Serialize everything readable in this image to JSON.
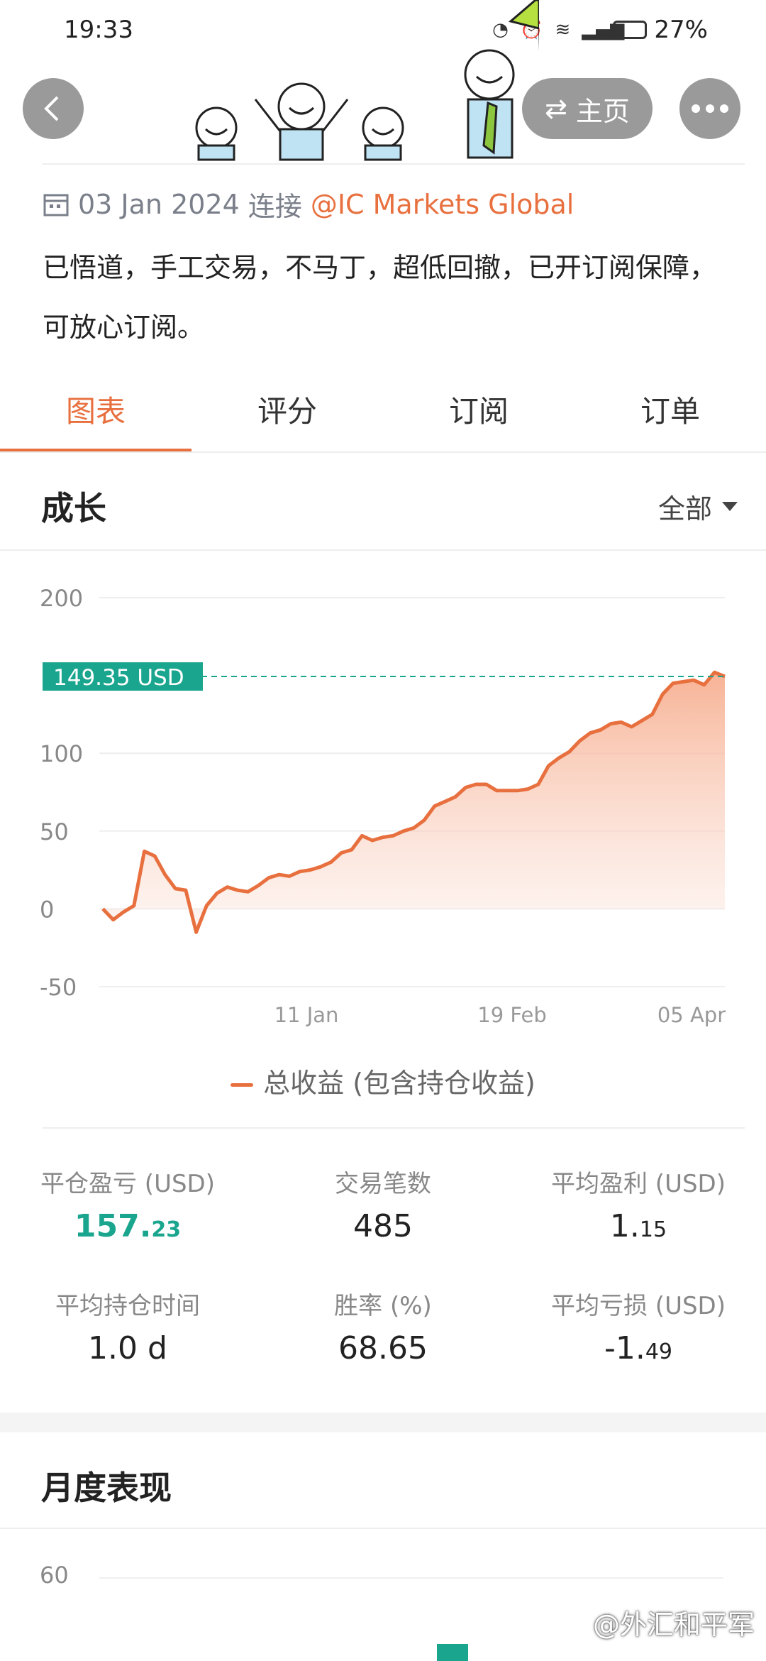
{
  "status_bar": {
    "time": "19:33",
    "battery": "27%"
  },
  "header": {
    "home_label": "主页"
  },
  "profile": {
    "date": "03 Jan 2024",
    "connect_label": "连接",
    "broker": "@IC Markets Global",
    "description": "已悟道，手工交易，不马丁，超低回撤，已开订阅保障，可放心订阅。"
  },
  "tabs": [
    {
      "label": "图表",
      "active": true
    },
    {
      "label": "评分",
      "active": false
    },
    {
      "label": "订阅",
      "active": false
    },
    {
      "label": "订单",
      "active": false
    }
  ],
  "growth": {
    "title": "成长",
    "filter": "全部",
    "current_badge": "149.35 USD"
  },
  "chart_data": {
    "type": "area",
    "ylim": [
      -50,
      200
    ],
    "yticks": [
      "200",
      "100",
      "50",
      "0",
      "-50"
    ],
    "xticks": [
      "11 Jan",
      "19 Feb",
      "05 Apr"
    ],
    "reference_value": 149.35,
    "series": [
      {
        "name": "总收益 (包含持仓收益)",
        "color": "#e8703f",
        "values": [
          0,
          -7,
          -2,
          2,
          37,
          34,
          22,
          13,
          12,
          -15,
          2,
          10,
          14,
          12,
          11,
          15,
          20,
          22,
          21,
          24,
          25,
          27,
          30,
          36,
          38,
          47,
          44,
          46,
          47,
          50,
          52,
          57,
          66,
          69,
          72,
          78,
          80,
          80,
          76,
          76,
          76,
          77,
          80,
          92,
          97,
          101,
          108,
          113,
          115,
          119,
          120,
          117,
          121,
          125,
          138,
          145,
          146,
          147,
          144,
          152,
          149.35
        ]
      }
    ]
  },
  "stats": [
    {
      "label": "平仓盈亏 (USD)",
      "int": "157.",
      "dec": "23",
      "accent": true
    },
    {
      "label": "交易笔数",
      "int": "485",
      "dec": "",
      "accent": false
    },
    {
      "label": "平均盈利 (USD)",
      "int": "1.",
      "dec": "15",
      "accent": false
    },
    {
      "label": "平均持仓时间",
      "int": "1.0 d",
      "dec": "",
      "accent": false
    },
    {
      "label": "胜率 (%)",
      "int": "68.65",
      "dec": "",
      "accent": false
    },
    {
      "label": "平均亏损 (USD)",
      "int": "-1.",
      "dec": "49",
      "accent": false
    }
  ],
  "monthly": {
    "title": "月度表现",
    "ytick_top": "60"
  },
  "watermark": "@外汇和平军",
  "colors": {
    "accent": "#e8703f",
    "green": "#1aa58e",
    "grey": "#7a7f8a"
  }
}
